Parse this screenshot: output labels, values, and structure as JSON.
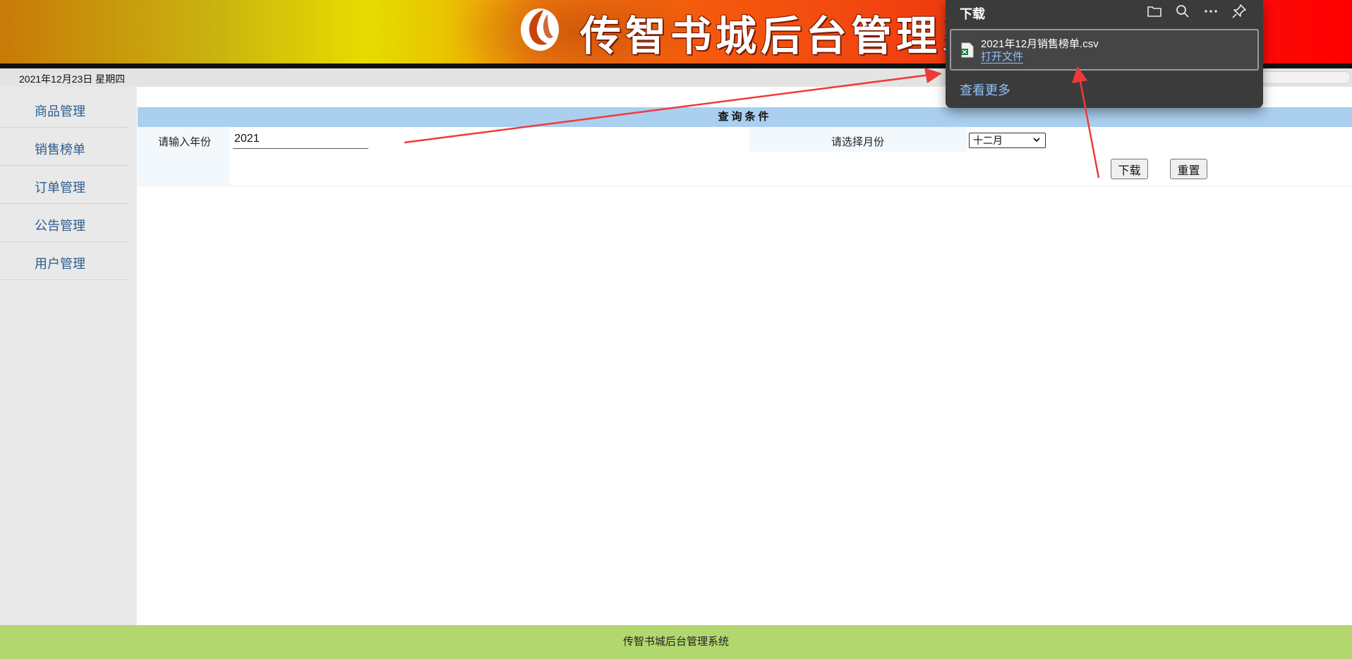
{
  "header": {
    "title": "传智书城后台管理系统",
    "logo_icon": "logo-mark-icon"
  },
  "date_bar": {
    "date": "2021年12月23日 星期四"
  },
  "sidebar": {
    "items": [
      {
        "label": "商品管理"
      },
      {
        "label": "销售榜单"
      },
      {
        "label": "订单管理"
      },
      {
        "label": "公告管理"
      },
      {
        "label": "用户管理"
      }
    ]
  },
  "query": {
    "header": "查询条件",
    "year_label": "请输入年份",
    "year_value": "2021",
    "month_label": "请选择月份",
    "month_value": "十二月",
    "download_button": "下载",
    "reset_button": "重置"
  },
  "footer": {
    "text": "传智书城后台管理系统"
  },
  "download_panel": {
    "title": "下载",
    "file_name": "2021年12月销售榜单.csv",
    "open_file": "打开文件",
    "see_more": "查看更多",
    "tool_icons": [
      "folder-icon",
      "search-icon",
      "more-icon",
      "pin-icon"
    ]
  },
  "colors": {
    "sidebar_bg": "#e9e9e9",
    "query_header_bg": "#aacfef",
    "footer_bg": "#b2d76f",
    "panel_bg": "#3b3b3b",
    "link_blue": "#8ec1ff",
    "arrow_red": "#f03a3a"
  }
}
